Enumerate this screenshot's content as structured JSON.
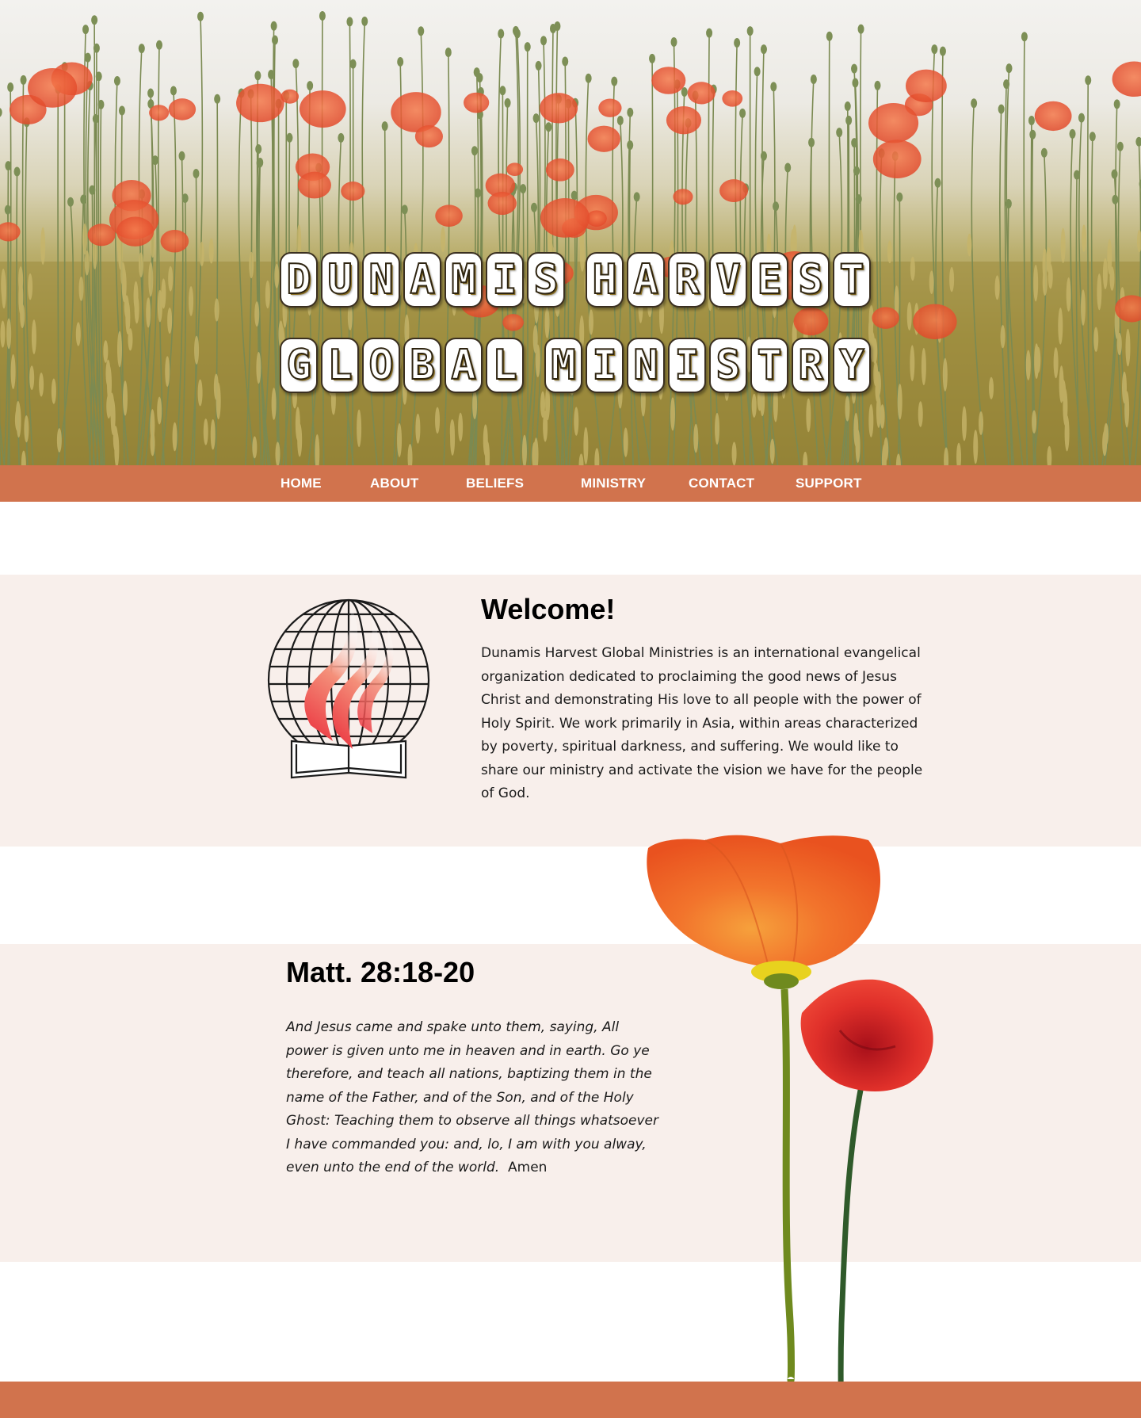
{
  "hero": {
    "title_line1": [
      "Dunamis",
      "Harvest"
    ],
    "title_line2": [
      "Global",
      "Ministry"
    ]
  },
  "nav": {
    "items": [
      {
        "label": "HOME"
      },
      {
        "label": "ABOUT"
      },
      {
        "label": "BELIEFS"
      },
      {
        "label": "MINISTRY"
      },
      {
        "label": "CONTACT"
      },
      {
        "label": "SUPPORT"
      }
    ]
  },
  "welcome": {
    "title": "Welcome!",
    "text": "Dunamis Harvest Global Ministries is an international evangelical organization dedicated to proclaiming the good news of Jesus Christ and demonstrating His love to all people with the power of Holy Spirit.   We work primarily in Asia, within areas characterized by poverty, spiritual darkness, and suffering.  We would like to share our ministry and activate the vision we have for the people of God."
  },
  "verse": {
    "title": "Matt. 28:18-20",
    "text": "And Jesus came and spake unto them, saying, All power is given unto me in heaven and in earth. Go ye therefore, and teach all nations, baptizing them in the name of the Father, and of the Son, and of the Holy Ghost: Teaching them to observe all things whatsoever I have commanded you: and, lo, I am with you alway, even unto the end of the world.",
    "amen": "Amen"
  },
  "colors": {
    "accent": "#d1734d",
    "band": "#f8efeb"
  },
  "icons": {
    "logo": "globe-flame-book-logo",
    "poppies": "poppy-flowers-image"
  }
}
